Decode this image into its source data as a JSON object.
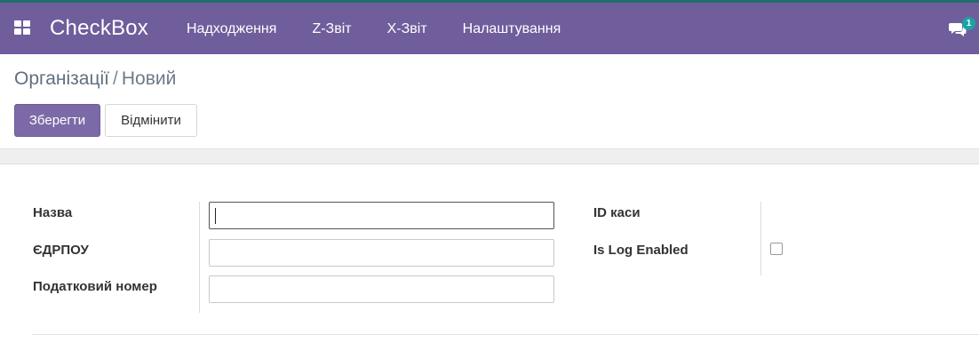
{
  "navbar": {
    "brand": "CheckBox",
    "menu": [
      "Надходження",
      "Z-Звіт",
      "X-Звіт",
      "Налаштування"
    ],
    "chat_badge": "1",
    "accent_color": "#705d9c"
  },
  "breadcrumb": {
    "parent": "Організації",
    "separator": "/",
    "current": "Новий"
  },
  "actions": {
    "save": "Зберегти",
    "discard": "Відмінити"
  },
  "form": {
    "name_label": "Назва",
    "name_value": "",
    "edrpou_label": "ЄДРПОУ",
    "edrpou_value": "",
    "tax_label": "Податковий номер",
    "tax_value": "",
    "cash_id_label": "ID каси",
    "log_label": "Is Log Enabled",
    "log_enabled": false
  }
}
